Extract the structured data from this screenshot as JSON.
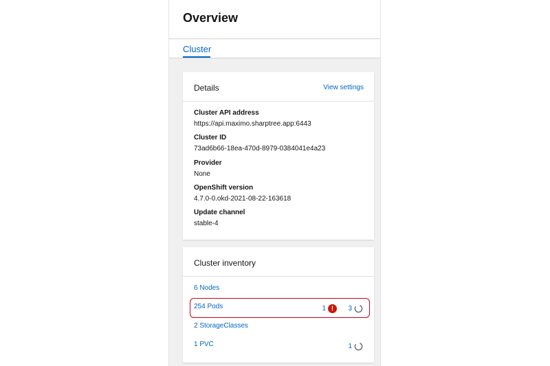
{
  "page": {
    "title": "Overview"
  },
  "tabs": [
    {
      "label": "Cluster",
      "active": true
    }
  ],
  "details": {
    "title": "Details",
    "view_settings_label": "View settings",
    "fields": [
      {
        "term": "Cluster API address",
        "value": "https://api.maximo.sharptree.app:6443"
      },
      {
        "term": "Cluster ID",
        "value": "73ad6b66-18ea-470d-8979-0384041e4a23"
      },
      {
        "term": "Provider",
        "value": "None"
      },
      {
        "term": "OpenShift version",
        "value": "4.7.0-0.okd-2021-08-22-163618"
      },
      {
        "term": "Update channel",
        "value": "stable-4"
      }
    ]
  },
  "inventory": {
    "title": "Cluster inventory",
    "items": [
      {
        "label": "6 Nodes"
      },
      {
        "label": "254 Pods",
        "error_count": "1",
        "progress_count": "3",
        "highlighted": true
      },
      {
        "label": "2 StorageClasses"
      },
      {
        "label": "1 PVC",
        "progress_count": "1"
      }
    ]
  },
  "colors": {
    "link": "#0066cc",
    "error": "#c9190b",
    "highlight": "#d0021b",
    "background": "#f0f0f0"
  },
  "icons": {
    "error": "exclamation-circle-icon",
    "progress": "in-progress-icon"
  }
}
